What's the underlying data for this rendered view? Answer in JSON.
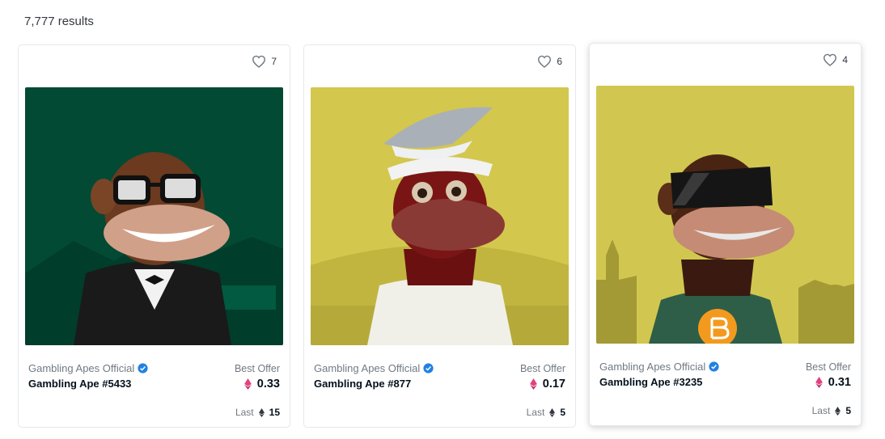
{
  "results": {
    "count_text": "7,777 results"
  },
  "cards": [
    {
      "favorites": "7",
      "collection": "Gambling Apes Official",
      "name": "Gambling Ape #5433",
      "offer_label": "Best Offer",
      "offer_price": "0.33",
      "last_label": "Last",
      "last_price": "15",
      "bg_color": "#024a34"
    },
    {
      "favorites": "6",
      "collection": "Gambling Apes Official",
      "name": "Gambling Ape #877",
      "offer_label": "Best Offer",
      "offer_price": "0.17",
      "last_label": "Last",
      "last_price": "5",
      "bg_color": "#d3c74d"
    },
    {
      "favorites": "4",
      "collection": "Gambling Apes Official",
      "name": "Gambling Ape #3235",
      "offer_label": "Best Offer",
      "offer_price": "0.31",
      "last_label": "Last",
      "last_price": "5",
      "bg_color": "#d1c750"
    }
  ],
  "colors": {
    "verified": "#2081e2",
    "offer_eth": "#e2407f",
    "last_eth": "#353840"
  },
  "icons": {
    "favorite": "heart-outline-icon",
    "verified": "verified-badge-icon",
    "currency": "ethereum-icon"
  }
}
